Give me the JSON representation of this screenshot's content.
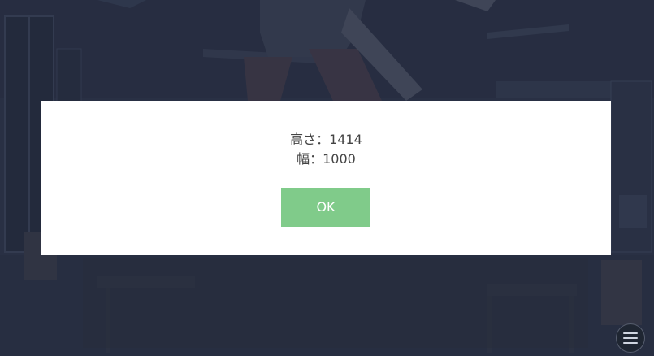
{
  "dialog": {
    "lines": [
      "高さ：1414",
      "幅：1000"
    ],
    "ok_label": "OK",
    "ok_color": "#80cb8a"
  },
  "menu": {
    "icon": "hamburger-menu-icon"
  },
  "colors": {
    "overlay": "#2f3547",
    "dialog_bg": "#ffffff",
    "text": "#444444"
  }
}
